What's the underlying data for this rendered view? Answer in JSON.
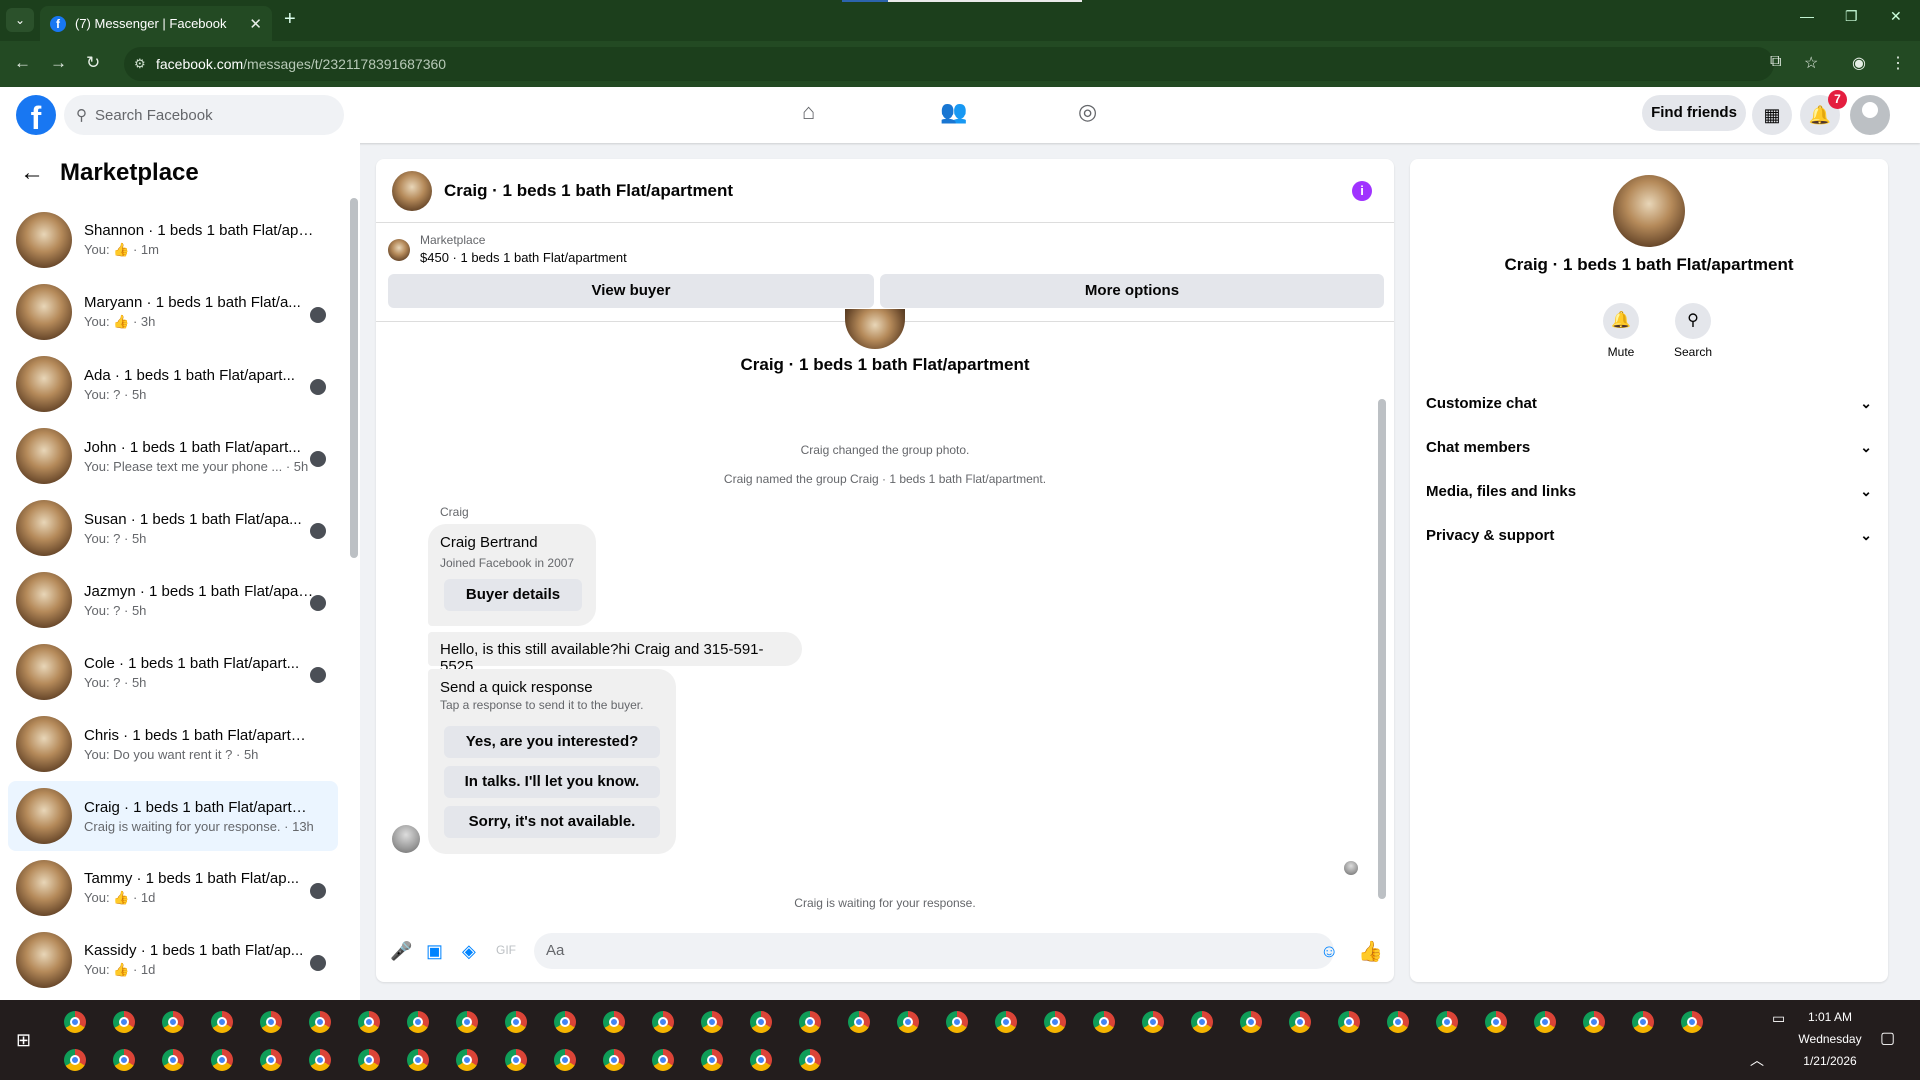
{
  "browser": {
    "tab_title": "(7) Messenger | Facebook",
    "url_host": "facebook.com",
    "url_path": "/messages/t/2321178391687360"
  },
  "fb": {
    "search_placeholder": "Search Facebook",
    "find_friends": "Find friends",
    "notif_count": "7"
  },
  "left": {
    "title": "Marketplace",
    "conversations": [
      {
        "name": "Shannon · 1 beds 1 bath Flat/apa...",
        "sub": "You: 👍 · 1m"
      },
      {
        "name": "Maryann · 1 beds 1 bath Flat/a...",
        "sub": "You: 👍 · 3h"
      },
      {
        "name": "Ada · 1 beds 1 bath Flat/apart...",
        "sub": "You: ? · 5h"
      },
      {
        "name": "John · 1 beds 1 bath Flat/apart...",
        "sub": "You: Please text me your phone ... · 5h"
      },
      {
        "name": "Susan · 1 beds 1 bath Flat/apa...",
        "sub": "You: ? · 5h"
      },
      {
        "name": "Jazmyn · 1 beds 1 bath Flat/apar...",
        "sub": "You: ? · 5h"
      },
      {
        "name": "Cole · 1 beds 1 bath Flat/apart...",
        "sub": "You: ? · 5h"
      },
      {
        "name": "Chris · 1 beds 1 bath Flat/apartm...",
        "sub": "You: Do you want rent it ? · 5h"
      },
      {
        "name": "Craig · 1 beds 1 bath Flat/apartm...",
        "sub": "Craig is waiting for your response. · 13h"
      },
      {
        "name": "Tammy · 1 beds 1 bath Flat/ap...",
        "sub": "You: 👍 · 1d"
      },
      {
        "name": "Kassidy · 1 beds 1 bath Flat/ap...",
        "sub": "You: 👍 · 1d"
      }
    ]
  },
  "chat": {
    "title": "Craig · 1 beds 1 bath Flat/apartment",
    "marketplace_label": "Marketplace",
    "listing": "$450 · 1 beds 1 bath Flat/apartment",
    "view_buyer": "View buyer",
    "more_options": "More options",
    "center_name": "Craig · 1 beds 1 bath Flat/apartment",
    "sys1": "Craig changed the group photo.",
    "sys2": "Craig named the group Craig · 1 beds 1 bath Flat/apartment.",
    "sender": "Craig",
    "card_name": "Craig Bertrand",
    "card_sub": "Joined Facebook in 2007",
    "buyer_details": "Buyer details",
    "message": "Hello, is this still available?hi Craig and 315-591-5525",
    "quick_title": "Send a quick response",
    "quick_sub": "Tap a response to send it to the buyer.",
    "quick": [
      "Yes, are you interested?",
      "In talks. I'll let you know.",
      "Sorry, it's not available."
    ],
    "waiting": "Craig is waiting for your response.",
    "composer_placeholder": "Aa"
  },
  "right": {
    "name": "Craig · 1 beds 1 bath Flat/apartment",
    "mute": "Mute",
    "search": "Search",
    "sections": [
      "Customize chat",
      "Chat members",
      "Media, files and links",
      "Privacy & support"
    ]
  },
  "taskbar": {
    "time": "1:01 AM",
    "day": "Wednesday",
    "date": "1/21/2026"
  }
}
